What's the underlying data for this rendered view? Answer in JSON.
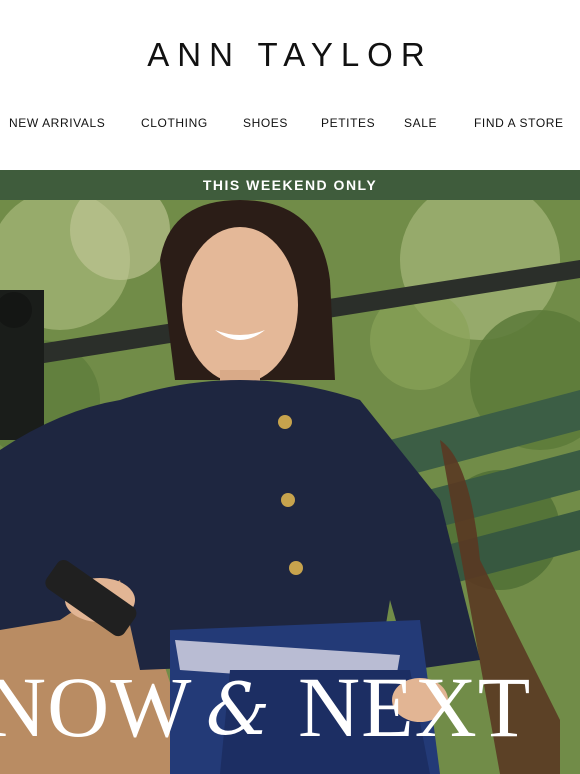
{
  "brand": {
    "name": "ANN TAYLOR"
  },
  "nav": {
    "items": [
      {
        "label": "NEW ARRIVALS"
      },
      {
        "label": "CLOTHING"
      },
      {
        "label": "SHOES"
      },
      {
        "label": "PETITES"
      },
      {
        "label": "SALE"
      },
      {
        "label": "FIND A STORE"
      }
    ]
  },
  "promo": {
    "text": "THIS WEEKEND ONLY"
  },
  "hero": {
    "headline_left": "NOW",
    "headline_amp": "&",
    "headline_right": "NEXT"
  },
  "colors": {
    "promo_bar": "#3f5c3c",
    "sweater": "#1e2640",
    "foliage": "#6e8a46"
  }
}
